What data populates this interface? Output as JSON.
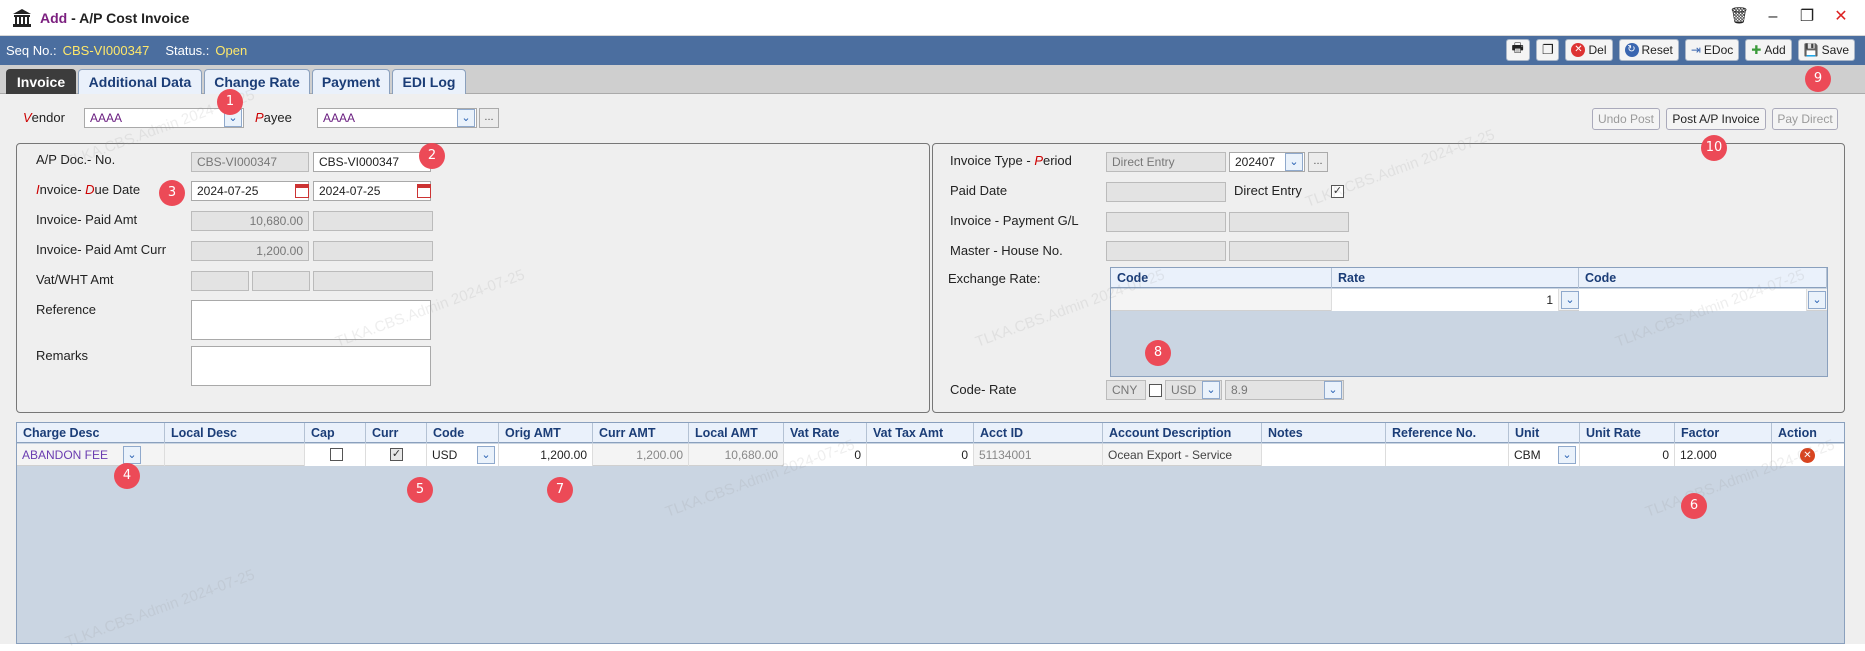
{
  "window": {
    "add_label": "Add",
    "title": " - A/P Cost Invoice"
  },
  "seq": {
    "label": "Seq No.:",
    "value": "CBS-VI000347",
    "status_label": "Status.:",
    "status_value": "Open"
  },
  "toolbar": {
    "del": "Del",
    "reset": "Reset",
    "edoc": "EDoc",
    "add": "Add",
    "save": "Save"
  },
  "tabs": [
    "Invoice",
    "Additional Data",
    "Change Rate",
    "Payment",
    "EDI Log"
  ],
  "vendor": {
    "label_v": "V",
    "label_rest": "endor",
    "value": "AAAA"
  },
  "payee": {
    "label_p": "P",
    "label_rest": "ayee",
    "value": "AAAA"
  },
  "actions": {
    "undo_post": "Undo Post",
    "post_ap": "Post A/P Invoice",
    "pay_direct": "Pay Direct"
  },
  "left": {
    "doc_no_label": "A/P Doc.- No.",
    "doc_no_1": "CBS-VI000347",
    "doc_no_2": "CBS-VI000347",
    "inv_due_i": "I",
    "inv_due_rest1": "nvoice- ",
    "inv_due_d": "D",
    "inv_due_rest2": "ue Date",
    "invoice_date": "2024-07-25",
    "due_date": "2024-07-25",
    "paid_amt_label": "Invoice- Paid Amt",
    "paid_amt": "10,680.00",
    "paid_amt_curr_label": "Invoice- Paid Amt Curr",
    "paid_amt_curr": "1,200.00",
    "vat_label": "Vat/WHT Amt",
    "reference_label": "Reference",
    "remarks_label": "Remarks"
  },
  "right": {
    "inv_type_label": "Invoice Type - ",
    "period_p": "P",
    "period_rest": "eriod",
    "inv_type": "Direct Entry",
    "period": "202407",
    "paid_date_label": "Paid Date",
    "direct_entry_label": "Direct Entry",
    "direct_entry_checked": true,
    "payment_gl_label": "Invoice -  Payment G/L",
    "house_no_label": "Master -  House No.",
    "exchange_label": "Exchange Rate:",
    "ex_cols": [
      "Code",
      "Rate",
      "Code"
    ],
    "ex_rate": "1",
    "code_rate_label": "Code- Rate",
    "code_rate_cur1": "CNY",
    "code_rate_cur2": "USD",
    "code_rate_val": "8.9"
  },
  "lines": {
    "columns": [
      "Charge Desc",
      "Local Desc",
      "Cap",
      "Curr",
      "Code",
      "Orig AMT",
      "Curr AMT",
      "Local AMT",
      "Vat Rate",
      "Vat Tax Amt",
      "Acct ID",
      "Account Description",
      "Notes",
      "Reference No.",
      "Unit",
      "Unit Rate",
      "Factor",
      "Action"
    ],
    "rows": [
      {
        "charge_desc": "ABANDON FEE",
        "local_desc": "",
        "cap": false,
        "curr": true,
        "code": "USD",
        "orig_amt": "1,200.00",
        "curr_amt": "1,200.00",
        "local_amt": "10,680.00",
        "vat_rate": "0",
        "vat_tax": "0",
        "acct_id": "51134001",
        "acct_desc": "Ocean Export - Service",
        "notes": "",
        "ref_no": "",
        "unit": "CBM",
        "unit_rate": "0",
        "factor": "12.000"
      }
    ]
  },
  "badges": [
    "1",
    "2",
    "3",
    "4",
    "5",
    "6",
    "7",
    "8",
    "9",
    "10"
  ],
  "watermark": "TLKA.CBS.Admin 2024-07-25",
  "colors": {
    "seqbar": "#4b6e9f",
    "accent": "#ffe86a",
    "badge": "#ec4a57",
    "header_blue": "#1b3d77"
  }
}
